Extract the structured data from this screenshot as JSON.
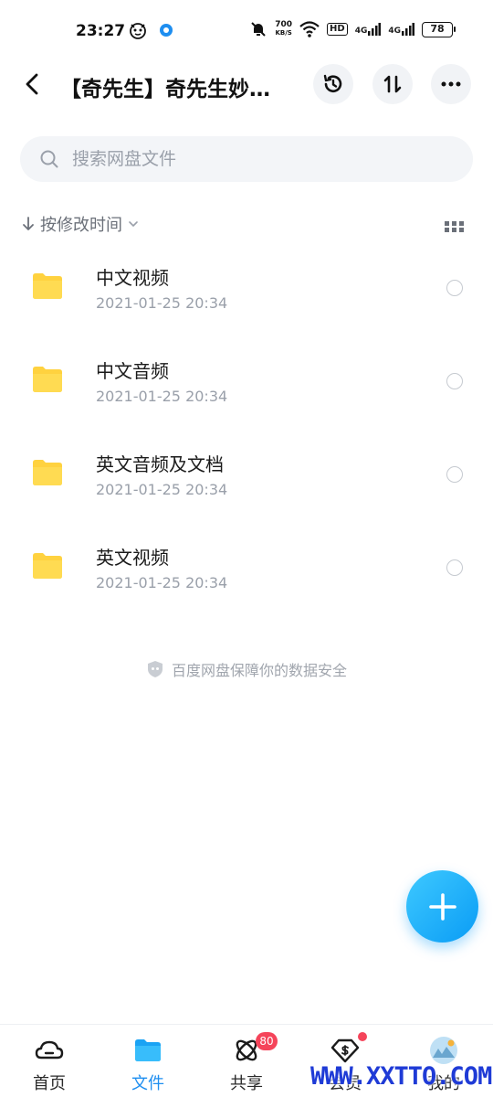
{
  "status_bar": {
    "time": "23:27",
    "net_speed_value": "700",
    "net_speed_unit": "KB/S",
    "hd_label": "HD",
    "signal1_label": "4G",
    "signal2_label": "4G",
    "battery": "78"
  },
  "header": {
    "title": "【奇先生】奇先生妙…"
  },
  "search": {
    "placeholder": "搜索网盘文件"
  },
  "sort": {
    "label": "按修改时间"
  },
  "files": [
    {
      "name": "中文视频",
      "time": "2021-01-25  20:34"
    },
    {
      "name": "中文音频",
      "time": "2021-01-25  20:34"
    },
    {
      "name": "英文音频及文档",
      "time": "2021-01-25  20:34"
    },
    {
      "name": "英文视频",
      "time": "2021-01-25  20:34"
    }
  ],
  "safety_note": "百度网盘保障你的数据安全",
  "nav": {
    "items": [
      {
        "label": "首页"
      },
      {
        "label": "文件"
      },
      {
        "label": "共享",
        "badge": "80"
      },
      {
        "label": "会员"
      },
      {
        "label": "我的"
      }
    ]
  },
  "colors": {
    "accent": "#1e8ef0",
    "folder": "#ffd23f",
    "badge": "#f5445a"
  },
  "watermark": "WWW.XXTTO.COM"
}
